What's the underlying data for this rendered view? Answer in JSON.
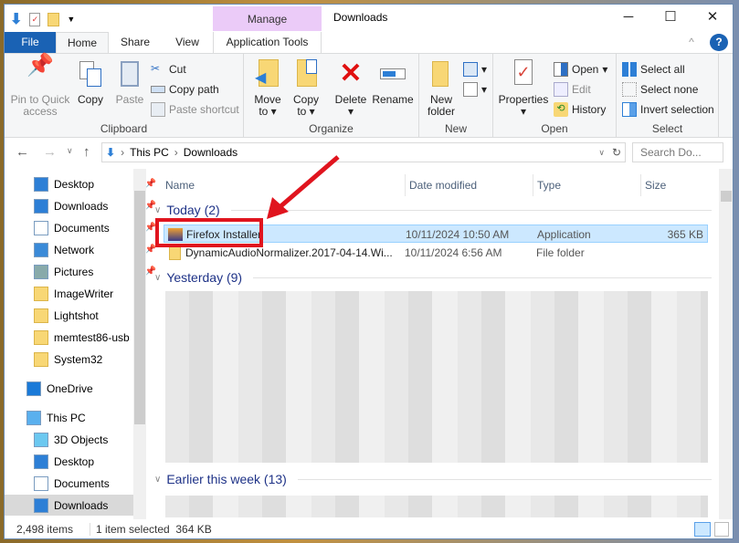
{
  "window": {
    "title": "Downloads",
    "manage_tab": "Manage",
    "minimize": "─",
    "maximize": "☐",
    "close": "✕"
  },
  "tabs": {
    "file": "File",
    "home": "Home",
    "share": "Share",
    "view": "View",
    "app_tools": "Application Tools"
  },
  "ribbon": {
    "clipboard": {
      "label": "Clipboard",
      "pin": "Pin to Quick access",
      "copy": "Copy",
      "paste": "Paste",
      "cut": "Cut",
      "copy_path": "Copy path",
      "paste_shortcut": "Paste shortcut"
    },
    "organize": {
      "label": "Organize",
      "move_to": "Move to",
      "copy_to": "Copy to",
      "delete": "Delete",
      "rename": "Rename"
    },
    "new": {
      "label": "New",
      "new_folder": "New folder"
    },
    "open": {
      "label": "Open",
      "properties": "Properties",
      "open": "Open",
      "edit": "Edit",
      "history": "History"
    },
    "select": {
      "label": "Select",
      "select_all": "Select all",
      "select_none": "Select none",
      "invert": "Invert selection"
    }
  },
  "address": {
    "crumbs": [
      "This PC",
      "Downloads"
    ],
    "search_placeholder": "Search Do..."
  },
  "nav": [
    {
      "label": "Desktop",
      "pinned": true
    },
    {
      "label": "Downloads",
      "pinned": true
    },
    {
      "label": "Documents",
      "pinned": true
    },
    {
      "label": "Network",
      "pinned": true
    },
    {
      "label": "Pictures",
      "pinned": true
    },
    {
      "label": "ImageWriter"
    },
    {
      "label": "Lightshot"
    },
    {
      "label": "memtest86-usb"
    },
    {
      "label": "System32"
    },
    {
      "label": "OneDrive"
    },
    {
      "label": "This PC"
    },
    {
      "label": "3D Objects"
    },
    {
      "label": "Desktop"
    },
    {
      "label": "Documents"
    },
    {
      "label": "Downloads",
      "selected": true
    }
  ],
  "columns": {
    "name": "Name",
    "date": "Date modified",
    "type": "Type",
    "size": "Size"
  },
  "groups": {
    "today": "Today (2)",
    "yesterday": "Yesterday (9)",
    "earlier": "Earlier this week (13)"
  },
  "files": [
    {
      "name": "Firefox Installer",
      "date": "10/11/2024 10:50 AM",
      "type": "Application",
      "size": "365 KB",
      "selected": true
    },
    {
      "name": "DynamicAudioNormalizer.2017-04-14.Wi...",
      "date": "10/11/2024 6:56 AM",
      "type": "File folder",
      "size": ""
    }
  ],
  "status": {
    "items": "2,498 items",
    "selected": "1 item selected  364 KB"
  },
  "colors": {
    "accent": "#1a62b4",
    "selection": "#cce8ff",
    "annotation": "#e0141e"
  }
}
